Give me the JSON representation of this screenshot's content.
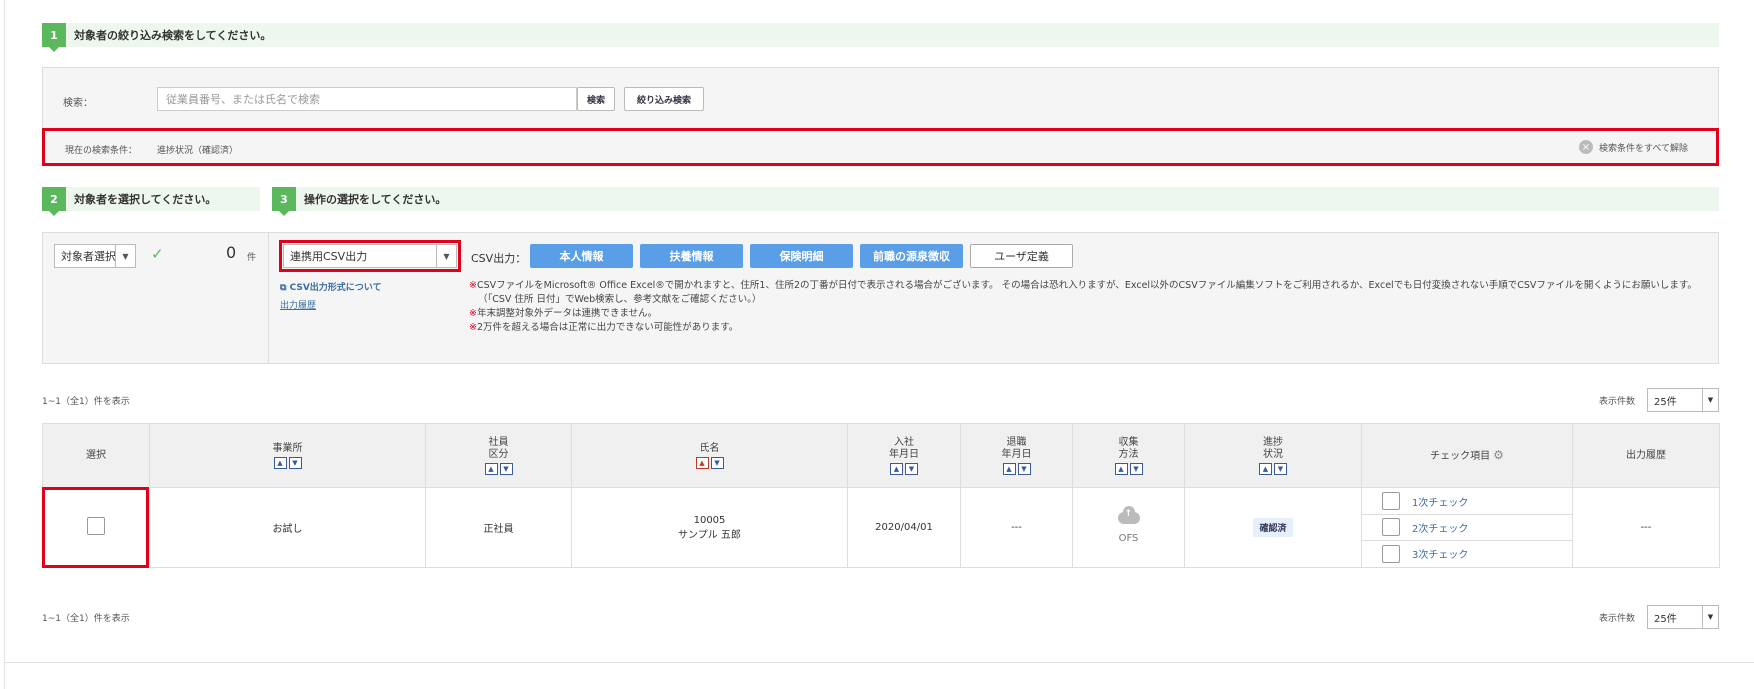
{
  "steps": [
    {
      "num": "1",
      "title": "対象者の絞り込み検索をしてください。"
    },
    {
      "num": "2",
      "title": "対象者を選択してください。"
    },
    {
      "num": "3",
      "title": "操作の選択をしてください。"
    }
  ],
  "search": {
    "label": "検索：",
    "placeholder": "従業員番号、または氏名で検索",
    "search_button": "検索",
    "filter_button": "絞り込み検索",
    "condition_label": "現在の検索条件：",
    "condition_value": "進捗状況（確認済）",
    "clear_all": "検索条件をすべて解除",
    "clear_icon": "×"
  },
  "selection": {
    "select_label": "対象者選択",
    "check_mark": "✓",
    "count": "0",
    "count_unit": "件"
  },
  "operation": {
    "select_value": "連携用CSV出力",
    "csv_format_link": "CSV出力形式について",
    "history_link": "出力履歴",
    "csv_label": "CSV出力：",
    "buttons": [
      "本人情報",
      "扶養情報",
      "保険明細",
      "前職の源泉徴収",
      "ユーザ定義"
    ],
    "notes": [
      "CSVファイルをMicrosoft® Office Excel®で開かれますと、住所1、住所2の丁番が日付で表示される場合がございます。 その場合は恐れ入りますが、Excel以外のCSVファイル編集ソフトをご利用されるか、Excelでも日付変換されない手順でCSVファイルを開くようにお願いします。 （「CSV 住所 日付」でWeb検索し、参考文献をご確認ください。）",
      "年末調整対象外データは連携できません。",
      "2万件を超える場合は正常に出力できない可能性があります。"
    ],
    "note_mark": "※"
  },
  "paging": {
    "count_text": "1~1（全1）件を表示",
    "per_page_label": "表示件数",
    "per_page_value": "25件"
  },
  "table": {
    "headers": {
      "select": "選択",
      "office": "事業所",
      "emp_type_1": "社員",
      "emp_type_2": "区分",
      "name": "氏名",
      "join_1": "入社",
      "join_2": "年月日",
      "leave_1": "退職",
      "leave_2": "年月日",
      "collect_1": "収集",
      "collect_2": "方法",
      "progress_1": "進捗",
      "progress_2": "状況",
      "check": "チェック項目",
      "history": "出力履歴"
    },
    "rows": [
      {
        "office": "お試し",
        "emp_type": "正社員",
        "emp_no": "10005",
        "name": "サンプル 五郎",
        "join_date": "2020/04/01",
        "leave_date": "---",
        "collect": "OFS",
        "progress": "確認済",
        "checks": [
          "1次チェック",
          "2次チェック",
          "3次チェック"
        ],
        "history": "---"
      }
    ]
  }
}
